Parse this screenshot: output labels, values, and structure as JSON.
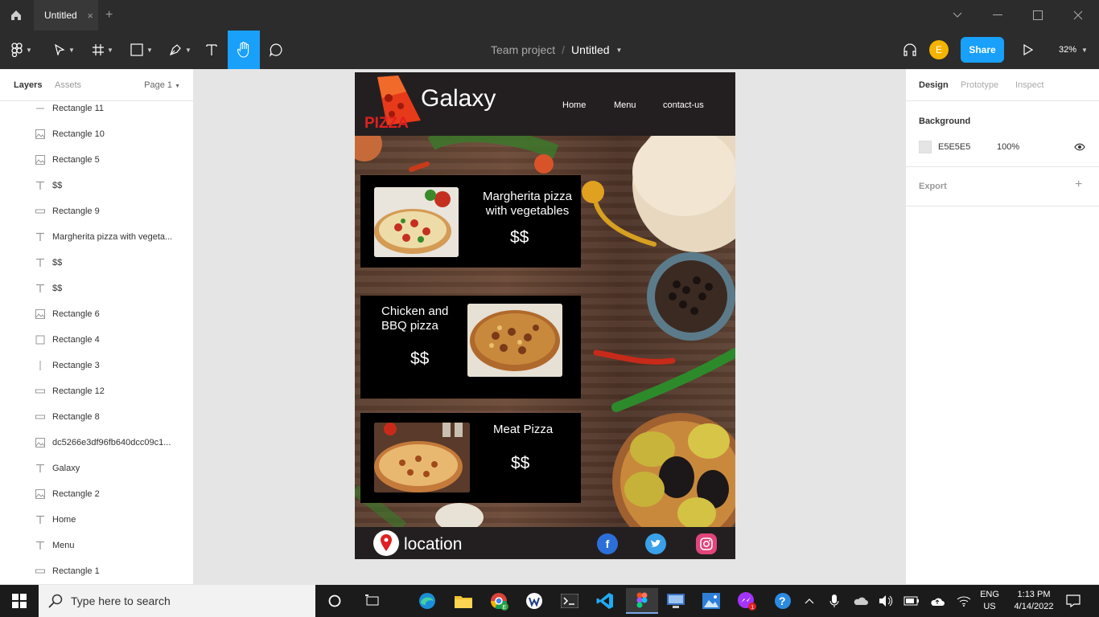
{
  "titlebar": {
    "tab_label": "Untitled",
    "close_glyph": "×",
    "add_glyph": "+"
  },
  "toolbar": {
    "project": "Team project",
    "separator": "/",
    "file_name": "Untitled",
    "share_label": "Share",
    "zoom": "32%",
    "avatar_initial": "E",
    "accent_color": "#18a0fb"
  },
  "left_panel": {
    "tabs": [
      "Layers",
      "Assets"
    ],
    "page": "Page 1",
    "layers": [
      {
        "icon": "line",
        "label": "Rectangle 11"
      },
      {
        "icon": "image",
        "label": "Rectangle 10"
      },
      {
        "icon": "image",
        "label": "Rectangle 5"
      },
      {
        "icon": "text",
        "label": "$$"
      },
      {
        "icon": "rect-thin",
        "label": "Rectangle 9"
      },
      {
        "icon": "text",
        "label": "Margherita pizza with vegeta..."
      },
      {
        "icon": "text",
        "label": "$$"
      },
      {
        "icon": "text",
        "label": "$$"
      },
      {
        "icon": "image",
        "label": "Rectangle 6"
      },
      {
        "icon": "rect",
        "label": "Rectangle 4"
      },
      {
        "icon": "vline",
        "label": "Rectangle 3"
      },
      {
        "icon": "rect-thin",
        "label": "Rectangle 12"
      },
      {
        "icon": "rect-thin",
        "label": "Rectangle 8"
      },
      {
        "icon": "image",
        "label": "dc5266e3df96fb640dcc09c1..."
      },
      {
        "icon": "text",
        "label": "Galaxy"
      },
      {
        "icon": "image",
        "label": "Rectangle 2"
      },
      {
        "icon": "text",
        "label": "Home"
      },
      {
        "icon": "text",
        "label": "Menu"
      },
      {
        "icon": "rect-thin",
        "label": "Rectangle 1"
      }
    ]
  },
  "design": {
    "logo_text": "PIZZA",
    "brand": "Galaxy",
    "nav": [
      "Home",
      "Menu",
      "contact-us"
    ],
    "cards": [
      {
        "title": "Margherita pizza with vegetables",
        "price": "$$"
      },
      {
        "title": "Chicken and BBQ pizza",
        "price": "$$"
      },
      {
        "title": "Meat Pizza",
        "price": "$$"
      }
    ],
    "footer_location": "location",
    "social": [
      "facebook",
      "twitter",
      "instagram"
    ]
  },
  "help_glyph": "?",
  "right_panel": {
    "tabs": [
      "Design",
      "Prototype",
      "Inspect"
    ],
    "background_label": "Background",
    "background_hex": "E5E5E5",
    "background_opacity": "100%",
    "export_label": "Export",
    "add_glyph": "+"
  },
  "taskbar": {
    "search_placeholder": "Type here to search",
    "language_top": "ENG",
    "language_bottom": "US",
    "time": "1:13 PM",
    "date": "4/14/2022",
    "messenger_badge": "1",
    "chrome_badge": "E"
  }
}
